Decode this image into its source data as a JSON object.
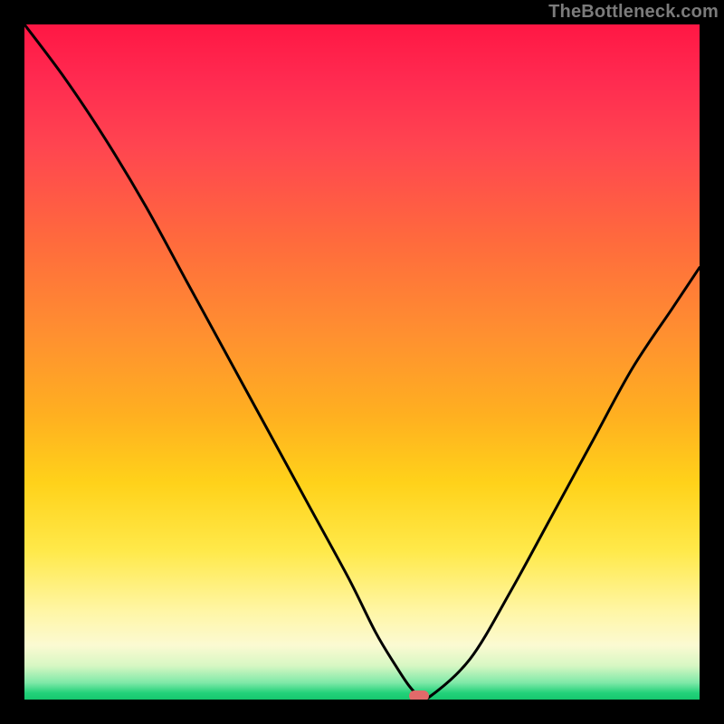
{
  "watermark": "TheBottleneck.com",
  "chart_data": {
    "type": "line",
    "title": "",
    "xlabel": "",
    "ylabel": "",
    "xlim": [
      0,
      100
    ],
    "ylim": [
      0,
      100
    ],
    "grid": false,
    "series": [
      {
        "name": "curve",
        "x": [
          0,
          6,
          12,
          18,
          24,
          30,
          36,
          42,
          48,
          52,
          55,
          57,
          58.5,
          60,
          66,
          72,
          78,
          84,
          90,
          96,
          100
        ],
        "values": [
          100,
          92,
          83,
          73,
          62,
          51,
          40,
          29,
          18,
          10,
          5,
          2,
          0.5,
          0.4,
          6,
          16,
          27,
          38,
          49,
          58,
          64
        ]
      }
    ],
    "annotations": [
      {
        "type": "marker",
        "shape": "pill",
        "color": "#e26a6a",
        "x": 58.5,
        "y": 0.5
      }
    ],
    "background": {
      "type": "vertical-gradient",
      "stops": [
        {
          "pos": 0.0,
          "color": "#ff1744"
        },
        {
          "pos": 0.32,
          "color": "#ff6a3d"
        },
        {
          "pos": 0.68,
          "color": "#ffd21a"
        },
        {
          "pos": 0.92,
          "color": "#fbfad2"
        },
        {
          "pos": 1.0,
          "color": "#16c76e"
        }
      ]
    }
  }
}
